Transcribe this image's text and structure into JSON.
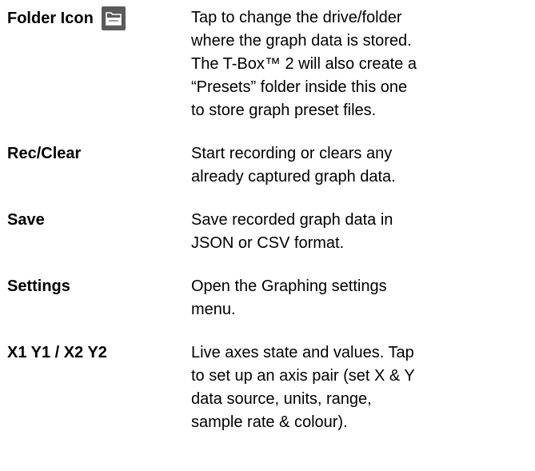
{
  "items": [
    {
      "term": "Folder Icon",
      "icon": "folder-icon",
      "description": "Tap to change the drive/folder\nwhere the graph data is stored.\nThe T-Box™ 2 will also create a\n“Presets” folder inside this one\nto store graph preset files."
    },
    {
      "term": "Rec/Clear",
      "description": "Start recording or clears any\nalready captured graph data."
    },
    {
      "term": "Save",
      "description": "Save recorded graph data in\nJSON or CSV format."
    },
    {
      "term": "Settings",
      "description": "Open the Graphing settings\nmenu."
    },
    {
      "term": "X1 Y1 / X2 Y2",
      "description": "Live axes state and values. Tap\nto set up an axis pair (set X & Y\ndata source, units, range,\nsample rate & colour)."
    }
  ],
  "colors": {
    "icon_background": "#5a5a5a",
    "icon_foreground": "#ffffff",
    "text": "#000000"
  }
}
